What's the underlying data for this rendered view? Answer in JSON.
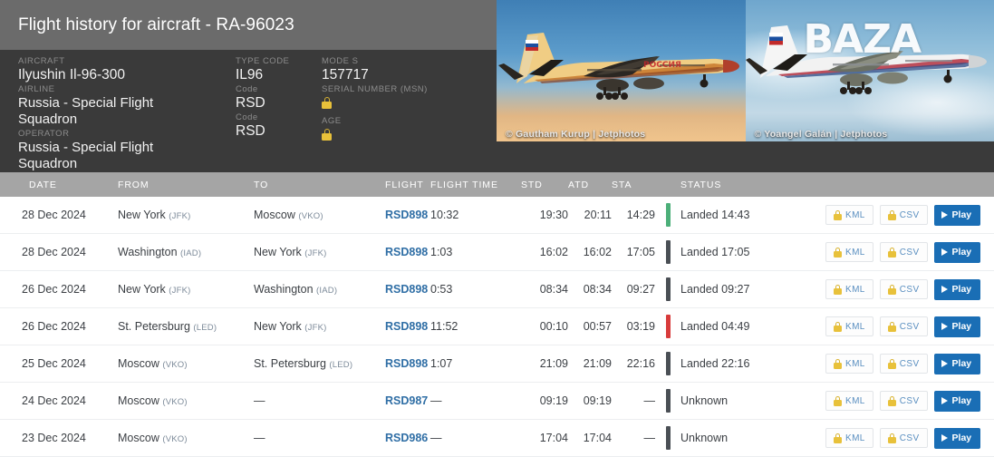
{
  "header": {
    "title": "Flight history for aircraft - RA-96023",
    "fields": {
      "aircraft_label": "AIRCRAFT",
      "aircraft_value": "Ilyushin Il-96-300",
      "airline_label": "AIRLINE",
      "airline_value": "Russia - Special Flight Squadron",
      "operator_label": "OPERATOR",
      "operator_value": "Russia - Special Flight Squadron",
      "type_code_label": "TYPE CODE",
      "type_code_value": "IL96",
      "airline_code_label": "Code",
      "airline_code_value": "RSD",
      "operator_code_label": "Code",
      "operator_code_value": "RSD",
      "mode_s_label": "MODE S",
      "mode_s_value": "157717",
      "serial_number_label": "SERIAL NUMBER (MSN)",
      "serial_number_value": "locked",
      "age_label": "AGE",
      "age_value": "locked"
    },
    "photos": [
      {
        "credit": "© Gautham Kurup | Jetphotos",
        "livery": "Rossiya orange"
      },
      {
        "credit": "© Yoangel Galán | Jetphotos",
        "livery": "white BAZA watermark",
        "watermark": "BAZA"
      }
    ]
  },
  "table": {
    "columns": {
      "date": "DATE",
      "from": "FROM",
      "to": "TO",
      "flight": "FLIGHT",
      "flight_time": "FLIGHT TIME",
      "std": "STD",
      "atd": "ATD",
      "sta": "STA",
      "status": "STATUS"
    },
    "actions": {
      "kml": "KML",
      "csv": "CSV",
      "play": "Play"
    },
    "colors": {
      "status_green": "#4caf79",
      "status_red": "#d83b3b",
      "status_gray": "#4a4f55",
      "play_blue": "#1a6eb5",
      "link_blue": "#2f6ea5",
      "lock_yellow": "#e8c13a"
    },
    "rows": [
      {
        "date": "28 Dec 2024",
        "from_city": "New York",
        "from_code": "(JFK)",
        "to_city": "Moscow",
        "to_code": "(VKO)",
        "flight": "RSD898",
        "flight_time": "10:32",
        "std": "19:30",
        "atd": "20:11",
        "sta": "14:29",
        "status": "Landed 14:43",
        "status_color": "green"
      },
      {
        "date": "28 Dec 2024",
        "from_city": "Washington",
        "from_code": "(IAD)",
        "to_city": "New York",
        "to_code": "(JFK)",
        "flight": "RSD898",
        "flight_time": "1:03",
        "std": "16:02",
        "atd": "16:02",
        "sta": "17:05",
        "status": "Landed 17:05",
        "status_color": "gray"
      },
      {
        "date": "26 Dec 2024",
        "from_city": "New York",
        "from_code": "(JFK)",
        "to_city": "Washington",
        "to_code": "(IAD)",
        "flight": "RSD898",
        "flight_time": "0:53",
        "std": "08:34",
        "atd": "08:34",
        "sta": "09:27",
        "status": "Landed 09:27",
        "status_color": "gray"
      },
      {
        "date": "26 Dec 2024",
        "from_city": "St. Petersburg",
        "from_code": "(LED)",
        "to_city": "New York",
        "to_code": "(JFK)",
        "flight": "RSD898",
        "flight_time": "11:52",
        "std": "00:10",
        "atd": "00:57",
        "sta": "03:19",
        "status": "Landed 04:49",
        "status_color": "red"
      },
      {
        "date": "25 Dec 2024",
        "from_city": "Moscow",
        "from_code": "(VKO)",
        "to_city": "St. Petersburg",
        "to_code": "(LED)",
        "flight": "RSD898",
        "flight_time": "1:07",
        "std": "21:09",
        "atd": "21:09",
        "sta": "22:16",
        "status": "Landed 22:16",
        "status_color": "gray"
      },
      {
        "date": "24 Dec 2024",
        "from_city": "Moscow",
        "from_code": "(VKO)",
        "to_city": "—",
        "to_code": "",
        "flight": "RSD987",
        "flight_time": "—",
        "std": "09:19",
        "atd": "09:19",
        "sta": "—",
        "status": "Unknown",
        "status_color": "gray"
      },
      {
        "date": "23 Dec 2024",
        "from_city": "Moscow",
        "from_code": "(VKO)",
        "to_city": "—",
        "to_code": "",
        "flight": "RSD986",
        "flight_time": "—",
        "std": "17:04",
        "atd": "17:04",
        "sta": "—",
        "status": "Unknown",
        "status_color": "gray"
      }
    ]
  }
}
